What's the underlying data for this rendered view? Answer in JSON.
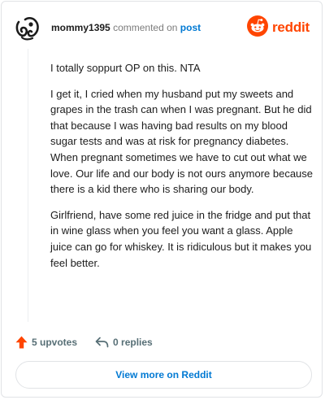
{
  "header": {
    "username": "mommy1395",
    "verb": "commented on",
    "target": "post",
    "brand": "reddit"
  },
  "comment": {
    "paragraphs": [
      "I totally soppurt OP on this. NTA",
      "I get it, I cried when my husband put my sweets and grapes in the trash can when I was pregnant. But he did that because I was having bad results on my blood sugar tests and was at risk for pregnancy diabetes. When pregnant sometimes we have to cut out what we love. Our life and our body is not ours anymore because there is a kid there who is sharing our body.",
      "Girlfriend, have some red juice in the fridge and put that in wine glass when you feel you want a glass. Apple juice can go for whiskey. It is ridiculous but it makes you feel better."
    ]
  },
  "actions": {
    "upvotes": "5 upvotes",
    "replies": "0 replies"
  },
  "footer": {
    "view_more": "View more on Reddit"
  },
  "icons": {
    "avatar": "avatar-icon",
    "brand": "reddit-snoo-icon",
    "upvote": "upvote-arrow-icon",
    "reply": "reply-arrow-icon"
  },
  "colors": {
    "brand": "#ff4500",
    "link": "#0079d3",
    "muted": "#576f76"
  }
}
